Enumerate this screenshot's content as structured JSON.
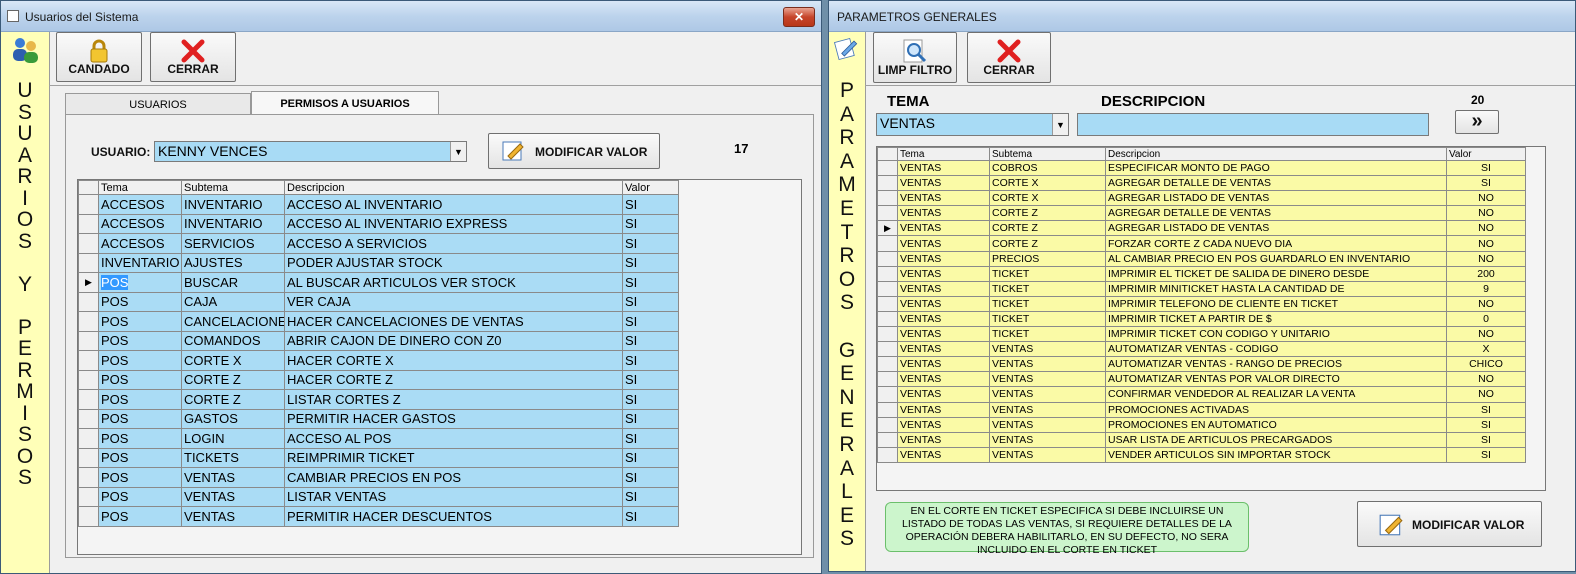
{
  "win1": {
    "title": "Usuarios del Sistema",
    "close_label": "✕",
    "sidebar_text": "USUARIOS Y PERMISOS",
    "toolbar": {
      "candado_label": "CANDADO",
      "cerrar_label": "CERRAR"
    },
    "tabs": [
      {
        "label": "USUARIOS"
      },
      {
        "label": "PERMISOS A USUARIOS"
      }
    ],
    "usuario_label": "USUARIO:",
    "usuario_value": "KENNY VENCES",
    "modificar_label": "MODIFICAR VALOR",
    "count": "17",
    "grid": {
      "headers": [
        "Tema",
        "Subtema",
        "Descripcion",
        "Valor"
      ],
      "rows": [
        [
          "ACCESOS",
          "INVENTARIO",
          "ACCESO AL INVENTARIO",
          "SI"
        ],
        [
          "ACCESOS",
          "INVENTARIO",
          "ACCESO AL INVENTARIO EXPRESS",
          "SI"
        ],
        [
          "ACCESOS",
          "SERVICIOS",
          "ACCESO A SERVICIOS",
          "SI"
        ],
        [
          "INVENTARIO",
          "AJUSTES",
          "PODER AJUSTAR STOCK",
          "SI"
        ],
        [
          "POS",
          "BUSCAR",
          "AL BUSCAR ARTICULOS VER STOCK",
          "SI"
        ],
        [
          "POS",
          "CAJA",
          "VER CAJA",
          "SI"
        ],
        [
          "POS",
          "CANCELACIONES",
          "HACER CANCELACIONES DE VENTAS",
          "SI"
        ],
        [
          "POS",
          "COMANDOS",
          "ABRIR CAJON DE DINERO CON Z0",
          "SI"
        ],
        [
          "POS",
          "CORTE X",
          "HACER CORTE X",
          "SI"
        ],
        [
          "POS",
          "CORTE Z",
          "HACER CORTE Z",
          "SI"
        ],
        [
          "POS",
          "CORTE Z",
          "LISTAR CORTES Z",
          "SI"
        ],
        [
          "POS",
          "GASTOS",
          "PERMITIR HACER GASTOS",
          "SI"
        ],
        [
          "POS",
          "LOGIN",
          "ACCESO AL POS",
          "SI"
        ],
        [
          "POS",
          "TICKETS",
          "REIMPRIMIR TICKET",
          "SI"
        ],
        [
          "POS",
          "VENTAS",
          "CAMBIAR PRECIOS EN POS",
          "SI"
        ],
        [
          "POS",
          "VENTAS",
          "LISTAR VENTAS",
          "SI"
        ],
        [
          "POS",
          "VENTAS",
          "PERMITIR HACER DESCUENTOS",
          "SI"
        ]
      ],
      "current_row": 4
    }
  },
  "win2": {
    "title": "PARAMETROS GENERALES",
    "sidebar_text": "PARAMETROS GENERALES",
    "toolbar": {
      "limp_label": "LIMP FILTRO",
      "cerrar_label": "CERRAR"
    },
    "tema_label": "TEMA",
    "tema_value": "VENTAS",
    "descripcion_label": "DESCRIPCION",
    "descripcion_value": "",
    "count": "20",
    "next_label": "»",
    "grid": {
      "headers": [
        "Tema",
        "Subtema",
        "Descripcion",
        "Valor"
      ],
      "rows": [
        [
          "VENTAS",
          "COBROS",
          "ESPECIFICAR MONTO DE PAGO",
          "SI"
        ],
        [
          "VENTAS",
          "CORTE X",
          "AGREGAR DETALLE DE VENTAS",
          "SI"
        ],
        [
          "VENTAS",
          "CORTE X",
          "AGREGAR LISTADO DE VENTAS",
          "NO"
        ],
        [
          "VENTAS",
          "CORTE Z",
          "AGREGAR DETALLE DE VENTAS",
          "NO"
        ],
        [
          "VENTAS",
          "CORTE Z",
          "AGREGAR LISTADO DE VENTAS",
          "NO"
        ],
        [
          "VENTAS",
          "CORTE Z",
          "FORZAR CORTE Z CADA NUEVO DIA",
          "NO"
        ],
        [
          "VENTAS",
          "PRECIOS",
          "AL CAMBIAR PRECIO EN POS GUARDARLO EN INVENTARIO",
          "NO"
        ],
        [
          "VENTAS",
          "TICKET",
          "IMPRIMIR EL TICKET DE SALIDA DE DINERO DESDE",
          "200"
        ],
        [
          "VENTAS",
          "TICKET",
          "IMPRIMIR MINITICKET HASTA LA CANTIDAD DE",
          "9"
        ],
        [
          "VENTAS",
          "TICKET",
          "IMPRIMIR TELEFONO DE CLIENTE EN TICKET",
          "NO"
        ],
        [
          "VENTAS",
          "TICKET",
          "IMPRIMIR TICKET A PARTIR DE $",
          "0"
        ],
        [
          "VENTAS",
          "TICKET",
          "IMPRIMIR TICKET CON CODIGO Y UNITARIO",
          "NO"
        ],
        [
          "VENTAS",
          "VENTAS",
          "AUTOMATIZAR VENTAS - CODIGO",
          "X"
        ],
        [
          "VENTAS",
          "VENTAS",
          "AUTOMATIZAR VENTAS - RANGO DE PRECIOS",
          "CHICO"
        ],
        [
          "VENTAS",
          "VENTAS",
          "AUTOMATIZAR VENTAS POR VALOR DIRECTO",
          "NO"
        ],
        [
          "VENTAS",
          "VENTAS",
          "CONFIRMAR VENDEDOR AL REALIZAR LA VENTA",
          "NO"
        ],
        [
          "VENTAS",
          "VENTAS",
          "PROMOCIONES ACTIVADAS",
          "SI"
        ],
        [
          "VENTAS",
          "VENTAS",
          "PROMOCIONES EN AUTOMATICO",
          "SI"
        ],
        [
          "VENTAS",
          "VENTAS",
          "USAR LISTA DE ARTICULOS PRECARGADOS",
          "SI"
        ],
        [
          "VENTAS",
          "VENTAS",
          "VENDER ARTICULOS SIN IMPORTAR STOCK",
          "SI"
        ]
      ],
      "current_row": 4
    },
    "note": "EN EL CORTE EN TICKET ESPECIFICA SI DEBE INCLUIRSE UN LISTADO DE TODAS LAS VENTAS, SI REQUIERE DETALLES DE LA OPERACIÓN DEBERA HABILITARLO, EN SU DEFECTO, NO SERA INCLUIDO EN EL CORTE EN TICKET",
    "modificar_label": "MODIFICAR VALOR"
  }
}
